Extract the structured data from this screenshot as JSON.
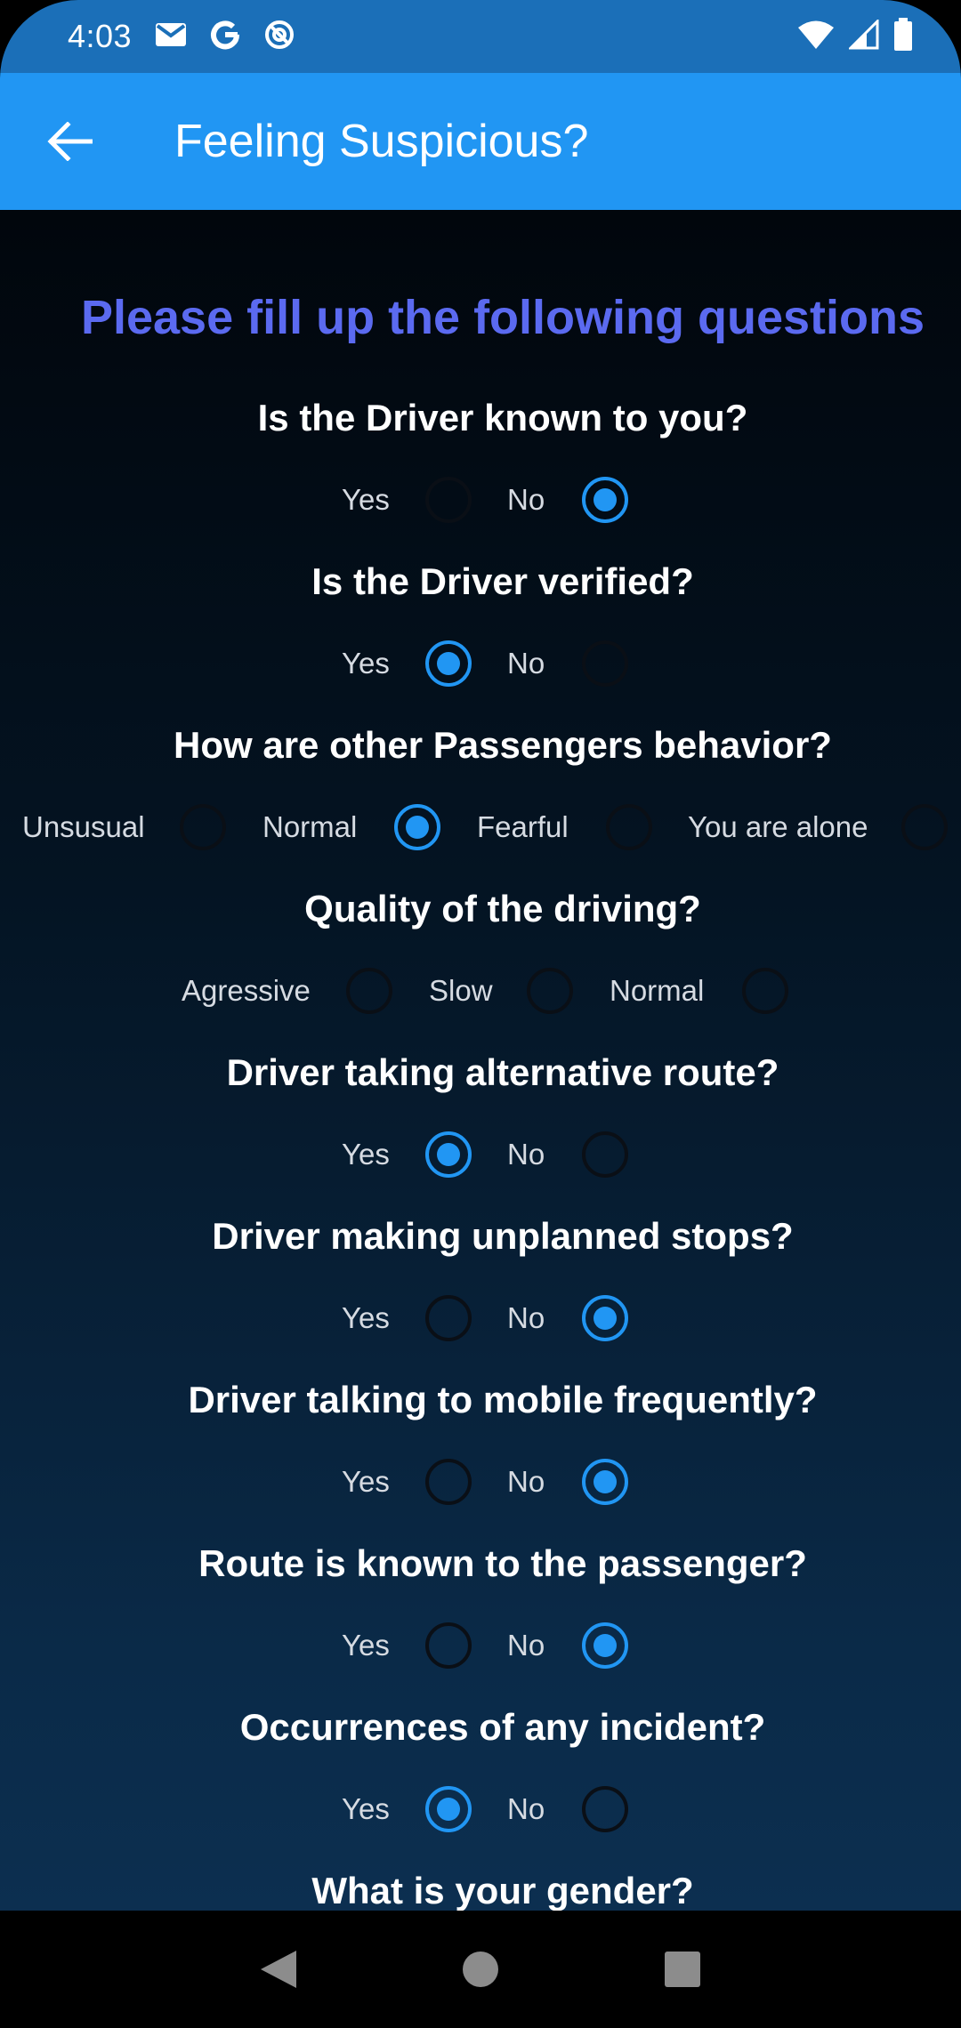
{
  "status_bar": {
    "time": "4:03",
    "left_icons": [
      "gmail-icon",
      "google-icon",
      "at-sign-icon"
    ],
    "right_icons": [
      "wifi-icon",
      "cellular-signal-icon",
      "battery-icon"
    ]
  },
  "app_bar": {
    "back_icon": "arrow-back-icon",
    "title": "Feeling Suspicious?",
    "color": "#2196f3"
  },
  "form": {
    "heading": "Please fill up the following questions",
    "questions": [
      {
        "text": "Is the Driver known to you?",
        "options": [
          "Yes",
          "No"
        ],
        "selected": "No"
      },
      {
        "text": "Is the Driver verified?",
        "options": [
          "Yes",
          "No"
        ],
        "selected": "Yes"
      },
      {
        "text": "How are other Passengers behavior?",
        "options": [
          "Unsusual",
          "Normal",
          "Fearful",
          "You are alone"
        ],
        "selected": "Normal"
      },
      {
        "text": "Quality of the driving?",
        "options": [
          "Agressive",
          "Slow",
          "Normal"
        ],
        "selected": null
      },
      {
        "text": "Driver taking alternative route?",
        "options": [
          "Yes",
          "No"
        ],
        "selected": "Yes"
      },
      {
        "text": "Driver making unplanned stops?",
        "options": [
          "Yes",
          "No"
        ],
        "selected": "No"
      },
      {
        "text": "Driver talking to mobile frequently?",
        "options": [
          "Yes",
          "No"
        ],
        "selected": "No"
      },
      {
        "text": "Route is known to the passenger?",
        "options": [
          "Yes",
          "No"
        ],
        "selected": "No"
      },
      {
        "text": "Occurrences of any incident?",
        "options": [
          "Yes",
          "No"
        ],
        "selected": "Yes"
      },
      {
        "text": "What is your gender?",
        "options": [],
        "selected": null
      }
    ]
  },
  "nav_bar": {
    "icons": [
      "back-triangle-icon",
      "home-circle-icon",
      "recents-square-icon"
    ]
  }
}
